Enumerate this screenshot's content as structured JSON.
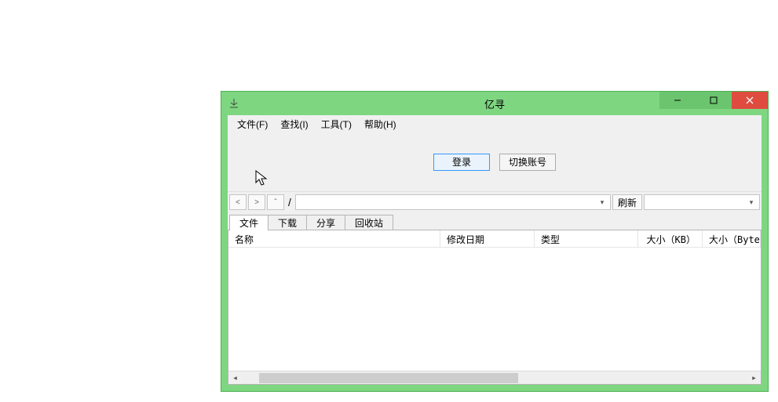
{
  "window": {
    "title": "亿寻"
  },
  "menu": {
    "file": "文件(F)",
    "find": "查找(I)",
    "tools": "工具(T)",
    "help": "帮助(H)"
  },
  "toolbar": {
    "login": "登录",
    "switch_account": "切换账号"
  },
  "nav": {
    "back": "<",
    "forward": ">",
    "up": "ˆ",
    "sep": "/",
    "path": "",
    "refresh": "刷新",
    "right_select": ""
  },
  "tabs": {
    "files": "文件",
    "download": "下载",
    "share": "分享",
    "recycle": "回收站"
  },
  "columns": {
    "name": "名称",
    "modified": "修改日期",
    "type": "类型",
    "size_kb": "大小（KB）",
    "size_byte": "大小（Byte）"
  },
  "rows": []
}
